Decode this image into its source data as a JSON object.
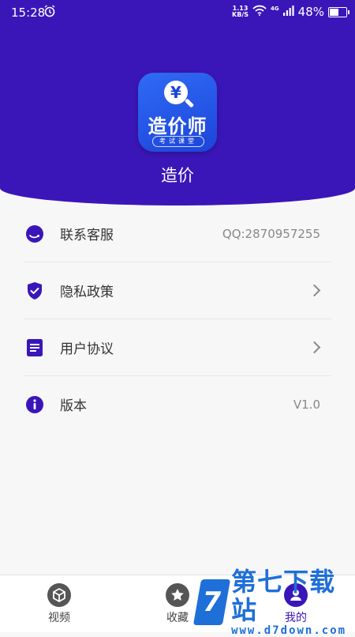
{
  "status_bar": {
    "time": "15:28",
    "net_speed_value": "1.13",
    "net_speed_unit": "KB/S",
    "network_type": "4G",
    "battery_percent": "48%",
    "battery_level": 0.48
  },
  "header": {
    "icon_symbol": "¥",
    "icon_title": "造价师",
    "icon_subtitle": "考试课堂",
    "app_name": "造价",
    "background_color": "#3a16b8"
  },
  "menu": {
    "items": [
      {
        "label": "联系客服",
        "value": "QQ:2870957255",
        "icon": "customer-service-icon"
      },
      {
        "label": "隐私政策",
        "icon": "shield-check-icon"
      },
      {
        "label": "用户协议",
        "icon": "document-icon"
      },
      {
        "label": "版本",
        "value": "V1.0",
        "icon": "info-icon"
      }
    ]
  },
  "tab_bar": {
    "tabs": [
      {
        "label": "视频",
        "icon": "cube-icon"
      },
      {
        "label": "收藏",
        "icon": "star-icon"
      },
      {
        "label": "我的",
        "icon": "user-icon",
        "active": true
      }
    ],
    "accent_color": "#3a16b8"
  },
  "watermark": {
    "logo_letter": "7",
    "title": "第七下载站",
    "url": "www.d7down.com"
  }
}
